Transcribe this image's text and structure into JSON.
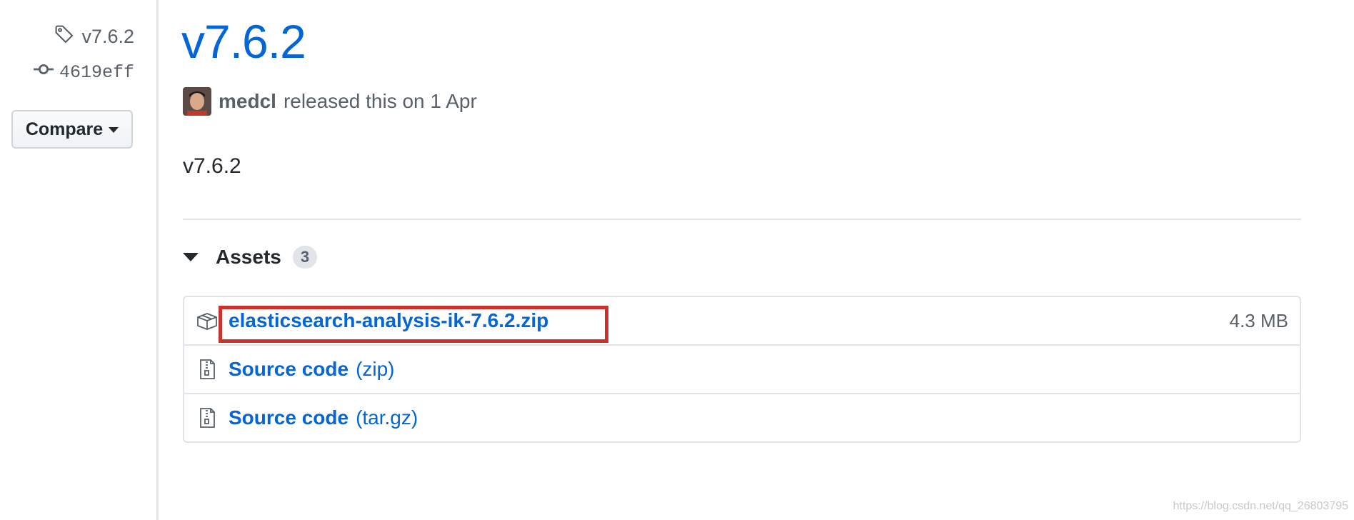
{
  "sidebar": {
    "tag": "v7.6.2",
    "commit": "4619eff",
    "compare_label": "Compare"
  },
  "release": {
    "title": "v7.6.2",
    "author": "medcl",
    "meta_text": "released this on 1 Apr",
    "body": "v7.6.2"
  },
  "assets": {
    "label": "Assets",
    "count": "3",
    "items": [
      {
        "name": "elasticsearch-analysis-ik-7.6.2.zip",
        "suffix": "",
        "size": "4.3 MB",
        "icon": "package-icon"
      },
      {
        "name": "Source code",
        "suffix": "(zip)",
        "size": "",
        "icon": "file-zip-icon"
      },
      {
        "name": "Source code",
        "suffix": "(tar.gz)",
        "size": "",
        "icon": "file-zip-icon"
      }
    ]
  },
  "watermark": "https://blog.csdn.net/qq_26803795",
  "colors": {
    "link": "#0366d6",
    "muted": "#586069",
    "border": "#e1e4e8",
    "highlight": "#c8342b"
  }
}
